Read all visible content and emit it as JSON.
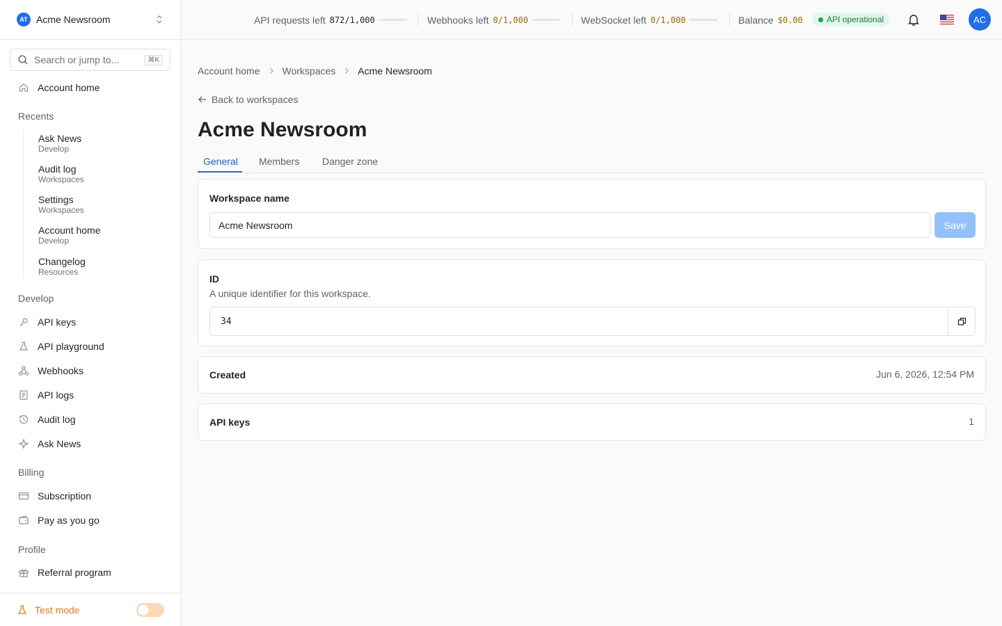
{
  "workspace": {
    "logo": "AT",
    "name": "Acme Newsroom"
  },
  "search": {
    "placeholder": "Search or jump to...",
    "shortcut": "⌘K"
  },
  "sidebar": {
    "account_home": "Account home",
    "recents_label": "Recents",
    "recents": [
      {
        "title": "Ask News",
        "sub": "Develop"
      },
      {
        "title": "Audit log",
        "sub": "Workspaces"
      },
      {
        "title": "Settings",
        "sub": "Workspaces"
      },
      {
        "title": "Account home",
        "sub": "Develop"
      },
      {
        "title": "Changelog",
        "sub": "Resources"
      }
    ],
    "develop_label": "Develop",
    "develop": [
      "API keys",
      "API playground",
      "Webhooks",
      "API logs",
      "Audit log",
      "Ask News"
    ],
    "billing_label": "Billing",
    "billing": [
      "Subscription",
      "Pay as you go"
    ],
    "profile_label": "Profile",
    "profile": [
      "Referral program"
    ],
    "test_mode": "Test mode"
  },
  "header": {
    "api_requests_label": "API requests left",
    "api_requests_value": "872/1,000",
    "webhooks_label": "Webhooks left",
    "webhooks_value": "0/1,000",
    "websocket_label": "WebSocket left",
    "websocket_value": "0/1,000",
    "balance_label": "Balance",
    "balance_value": "$0.00",
    "status": "API operational",
    "avatar": "AC"
  },
  "colors": {
    "accent": "#1e6fe8",
    "status_green": "#16a34a",
    "test_orange": "#e0791c",
    "usage_gold": "#9a6a00"
  },
  "breadcrumb": [
    "Account home",
    "Workspaces",
    "Acme Newsroom"
  ],
  "back_link": "Back to workspaces",
  "page_title": "Acme Newsroom",
  "tabs": [
    "General",
    "Members",
    "Danger zone"
  ],
  "cards": {
    "name": {
      "title": "Workspace name",
      "value": "Acme Newsroom",
      "save": "Save"
    },
    "id": {
      "title": "ID",
      "desc": "A unique identifier for this workspace.",
      "value": "34"
    },
    "created": {
      "title": "Created",
      "value": "Jun 6, 2026, 12:54 PM"
    },
    "api_keys": {
      "title": "API keys",
      "value": "1"
    }
  }
}
